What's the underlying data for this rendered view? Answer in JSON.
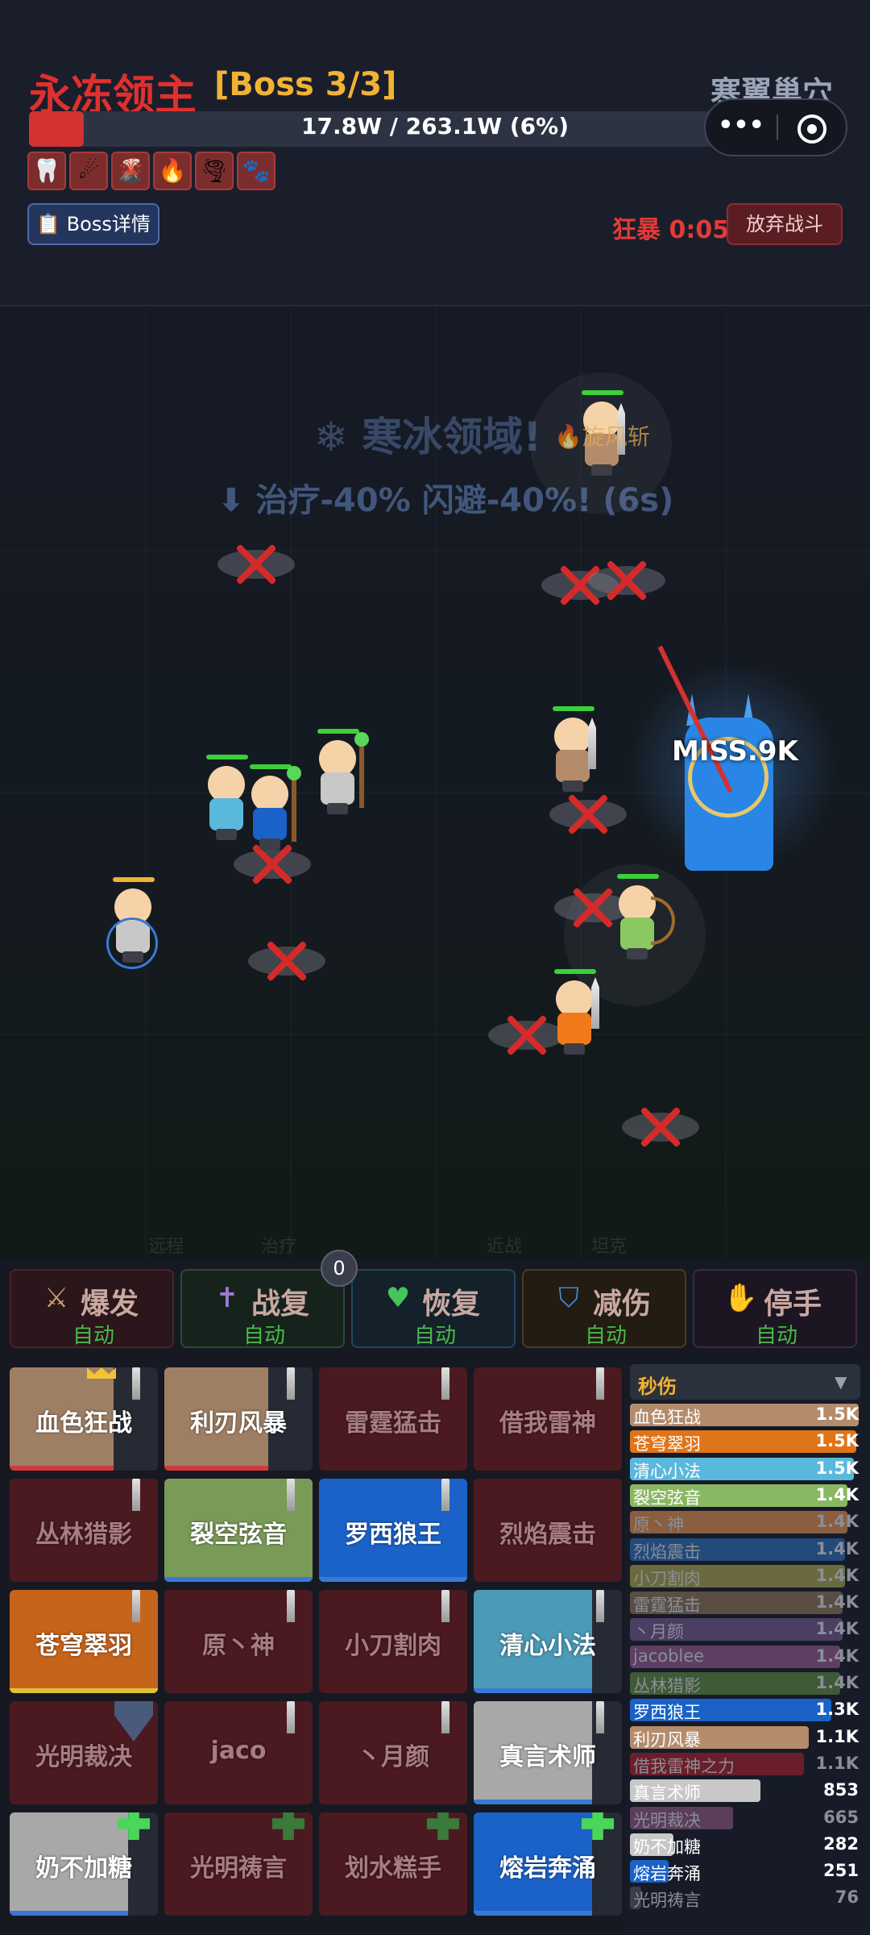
{
  "header": {
    "boss_name": "永冻领主",
    "boss_stage": "[Boss 3/3]",
    "zone_name": "寒翼巢穴",
    "hp_text": "17.8W / 263.1W (6%)",
    "hp_fraction": 0.06,
    "boss_detail_button": "📋 Boss详情",
    "berserk_label": "狂暴 0:05",
    "quit_button": "放弃战斗",
    "buff_icons": [
      {
        "icon": "tooth-icon",
        "glyph": "🦷"
      },
      {
        "icon": "comet-icon",
        "glyph": "☄"
      },
      {
        "icon": "volcano-icon",
        "glyph": "🌋"
      },
      {
        "icon": "fire-icon",
        "glyph": "🔥"
      },
      {
        "icon": "tornado-icon",
        "glyph": "🌪"
      },
      {
        "icon": "paw-icon",
        "glyph": "🐾"
      }
    ]
  },
  "miniprogram": {
    "more": "•••"
  },
  "arena": {
    "banner_title": "❄ 寒冰领域!",
    "banner_effect": "⬇ 治疗-40% 闪避-40%! (6s)",
    "skill_float": "🔥旋风斩",
    "damage_float": "MISS.9K",
    "lane_labels": [
      "远程",
      "治疗",
      "近战",
      "坦克"
    ]
  },
  "controls": {
    "counter": "0",
    "buttons": [
      {
        "label": "爆发",
        "sub": "自动",
        "icon": "⚔",
        "color": "#c9a070",
        "border": "#4a2428",
        "bg": "#2a161b"
      },
      {
        "label": "战复",
        "sub": "自动",
        "icon": "✝",
        "color": "#9d7ad0",
        "border": "#2c4a34",
        "bg": "#16221c"
      },
      {
        "label": "恢复",
        "sub": "自动",
        "icon": "♥",
        "color": "#46c35a",
        "border": "#22465a",
        "bg": "#14202a"
      },
      {
        "label": "减伤",
        "sub": "自动",
        "icon": "⛉",
        "color": "#4a88d6",
        "border": "#4a3d1e",
        "bg": "#221c12"
      },
      {
        "label": "停手",
        "sub": "自动",
        "icon": "✋",
        "color": "#e09a6a",
        "border": "#3d2a46",
        "bg": "#1c1622"
      }
    ]
  },
  "grid": [
    {
      "label": "血色狂战",
      "fill": "#9f7f64",
      "alive": true,
      "hp": 0.7,
      "bar": "#d23a3a",
      "sword": true,
      "crown": true
    },
    {
      "label": "利刃风暴",
      "fill": "#9f7f64",
      "alive": true,
      "hp": 0.7,
      "bar": "#d23a3a",
      "sword": true
    },
    {
      "label": "雷霆猛击",
      "alive": false,
      "sword": true
    },
    {
      "label": "借我雷神",
      "alive": false,
      "sword": true
    },
    {
      "label": "丛林猎影",
      "alive": false,
      "sword": true
    },
    {
      "label": "裂空弦音",
      "fill": "#7a9a58",
      "alive": true,
      "hp": 1.0,
      "bar": "#3a78d6",
      "sword": true
    },
    {
      "label": "罗西狼王",
      "fill": "#1a62c8",
      "alive": true,
      "hp": 1.0,
      "bar": "#3a78d6",
      "sword": true
    },
    {
      "label": "烈焰震击",
      "alive": false
    },
    {
      "label": "苍穹翠羽",
      "fill": "#c6641c",
      "alive": true,
      "hp": 1.0,
      "bar": "#e0c23a",
      "sword": true
    },
    {
      "label": "原丶神",
      "alive": false,
      "sword": true
    },
    {
      "label": "小刀割肉",
      "alive": false,
      "sword": true
    },
    {
      "label": "清心小法",
      "fill": "#4a9ab8",
      "alive": true,
      "hp": 0.8,
      "bar": "#3a78d6",
      "sword": true
    },
    {
      "label": "光明裁决",
      "alive": false,
      "shield": true
    },
    {
      "label": "jaco",
      "alive": false,
      "sword": true
    },
    {
      "label": "丶月颜",
      "alive": false,
      "sword": true
    },
    {
      "label": "真言术师",
      "fill": "#a8a8a8",
      "alive": true,
      "hp": 0.8,
      "bar": "#3a78d6",
      "sword": true
    },
    {
      "label": "奶不加糖",
      "fill": "#a8a8a8",
      "alive": true,
      "hp": 0.8,
      "bar": "#3a78d6",
      "cross": true
    },
    {
      "label": "光明祷言",
      "alive": false,
      "cross": true
    },
    {
      "label": "划水糕手",
      "alive": false,
      "cross": true
    },
    {
      "label": "熔岩奔涌",
      "fill": "#1a62c8",
      "alive": true,
      "hp": 0.8,
      "bar": "#3a78d6",
      "cross": true
    }
  ],
  "damage_panel": {
    "title": "秒伤",
    "rows": [
      {
        "name": "血色狂战",
        "value": "1.5K",
        "color": "#b48c6c",
        "fraction": 1.0,
        "alive": true
      },
      {
        "name": "苍穹翠羽",
        "value": "1.5K",
        "color": "#e07418",
        "fraction": 0.99,
        "alive": true
      },
      {
        "name": "清心小法",
        "value": "1.5K",
        "color": "#5ab8dc",
        "fraction": 0.98,
        "alive": true
      },
      {
        "name": "裂空弦音",
        "value": "1.4K",
        "color": "#8ab862",
        "fraction": 0.95,
        "alive": true
      },
      {
        "name": "原丶神",
        "value": "1.4K",
        "color": "#8a5e3e",
        "fraction": 0.95,
        "alive": false
      },
      {
        "name": "烈焰震击",
        "value": "1.4K",
        "color": "#224a7a",
        "fraction": 0.94,
        "alive": false
      },
      {
        "name": "小刀割肉",
        "value": "1.4K",
        "color": "#6a6a3e",
        "fraction": 0.94,
        "alive": false
      },
      {
        "name": "雷霆猛击",
        "value": "1.4K",
        "color": "#5a4e44",
        "fraction": 0.93,
        "alive": false
      },
      {
        "name": "丶月颜",
        "value": "1.4K",
        "color": "#4a3e62",
        "fraction": 0.93,
        "alive": false
      },
      {
        "name": "jacoblee",
        "value": "1.4K",
        "color": "#5e3e62",
        "fraction": 0.92,
        "alive": false
      },
      {
        "name": "丛林猎影",
        "value": "1.4K",
        "color": "#3e5a36",
        "fraction": 0.92,
        "alive": false
      },
      {
        "name": "罗西狼王",
        "value": "1.3K",
        "color": "#1a62c8",
        "fraction": 0.88,
        "alive": true
      },
      {
        "name": "利刃风暴",
        "value": "1.1K",
        "color": "#b48c6c",
        "fraction": 0.78,
        "alive": true
      },
      {
        "name": "借我雷神之力",
        "value": "1.1K",
        "color": "#6a1e2a",
        "fraction": 0.76,
        "alive": false
      },
      {
        "name": "真言术师",
        "value": "853",
        "color": "#c8c8c8",
        "fraction": 0.57,
        "alive": true
      },
      {
        "name": "光明裁决",
        "value": "665",
        "color": "#5a3e5a",
        "fraction": 0.45,
        "alive": false
      },
      {
        "name": "奶不加糖",
        "value": "282",
        "color": "#c8c8c8",
        "fraction": 0.19,
        "alive": true
      },
      {
        "name": "熔岩奔涌",
        "value": "251",
        "color": "#1a62c8",
        "fraction": 0.17,
        "alive": true
      },
      {
        "name": "光明祷言",
        "value": "76",
        "color": "#3a3e4a",
        "fraction": 0.05,
        "alive": false
      }
    ]
  }
}
